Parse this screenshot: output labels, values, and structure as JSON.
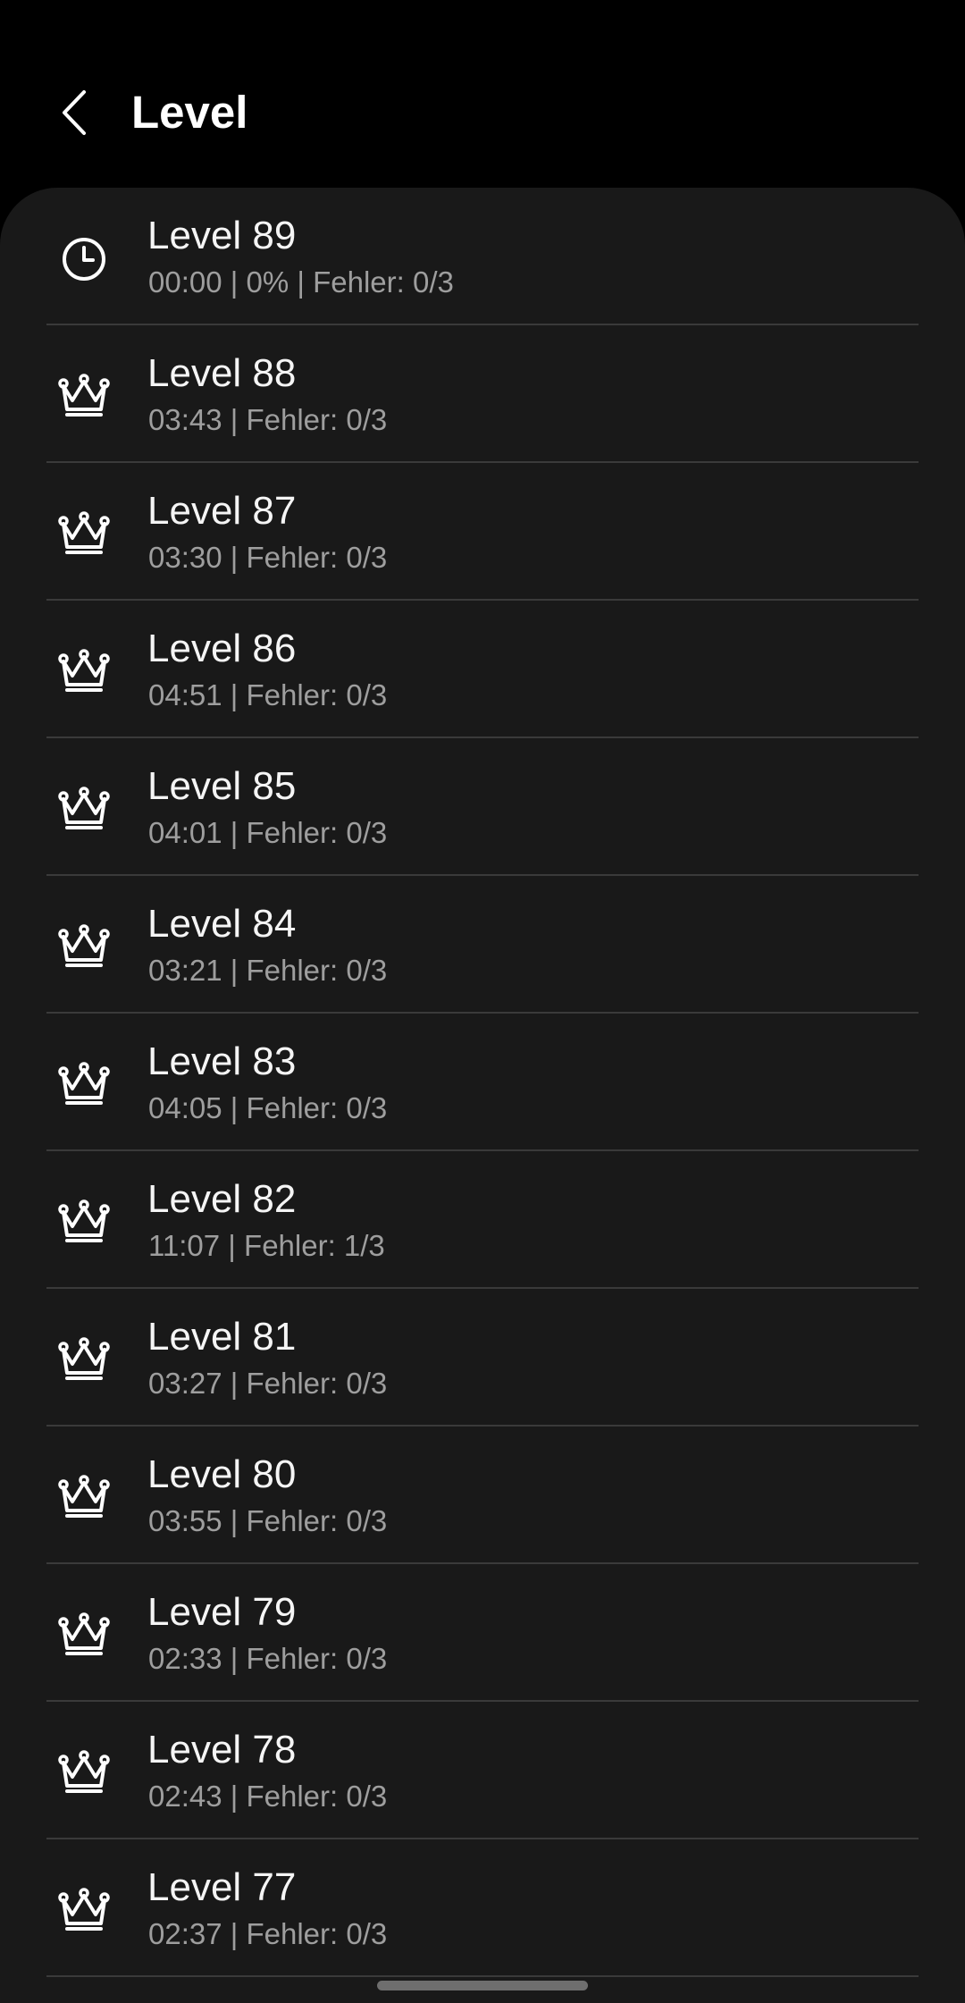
{
  "header": {
    "title": "Level",
    "back_icon": "chevron-left-icon"
  },
  "levels": [
    {
      "title": "Level 89",
      "subtitle": "00:00 | 0% | Fehler: 0/3",
      "icon": "clock-icon"
    },
    {
      "title": "Level 88",
      "subtitle": "03:43 | Fehler: 0/3",
      "icon": "crown-icon"
    },
    {
      "title": "Level 87",
      "subtitle": "03:30 | Fehler: 0/3",
      "icon": "crown-icon"
    },
    {
      "title": "Level 86",
      "subtitle": "04:51 | Fehler: 0/3",
      "icon": "crown-icon"
    },
    {
      "title": "Level 85",
      "subtitle": "04:01 | Fehler: 0/3",
      "icon": "crown-icon"
    },
    {
      "title": "Level 84",
      "subtitle": "03:21 | Fehler: 0/3",
      "icon": "crown-icon"
    },
    {
      "title": "Level 83",
      "subtitle": "04:05 | Fehler: 0/3",
      "icon": "crown-icon"
    },
    {
      "title": "Level 82",
      "subtitle": "11:07 | Fehler: 1/3",
      "icon": "crown-icon"
    },
    {
      "title": "Level 81",
      "subtitle": "03:27 | Fehler: 0/3",
      "icon": "crown-icon"
    },
    {
      "title": "Level 80",
      "subtitle": "03:55 | Fehler: 0/3",
      "icon": "crown-icon"
    },
    {
      "title": "Level 79",
      "subtitle": "02:33 | Fehler: 0/3",
      "icon": "crown-icon"
    },
    {
      "title": "Level 78",
      "subtitle": "02:43 | Fehler: 0/3",
      "icon": "crown-icon"
    },
    {
      "title": "Level 77",
      "subtitle": "02:37 | Fehler: 0/3",
      "icon": "crown-icon"
    }
  ],
  "colors": {
    "background": "#000000",
    "card": "#191919",
    "title_text": "#ffffff",
    "subtitle_text": "#9e9e9e",
    "divider": "#3a3a3a"
  }
}
